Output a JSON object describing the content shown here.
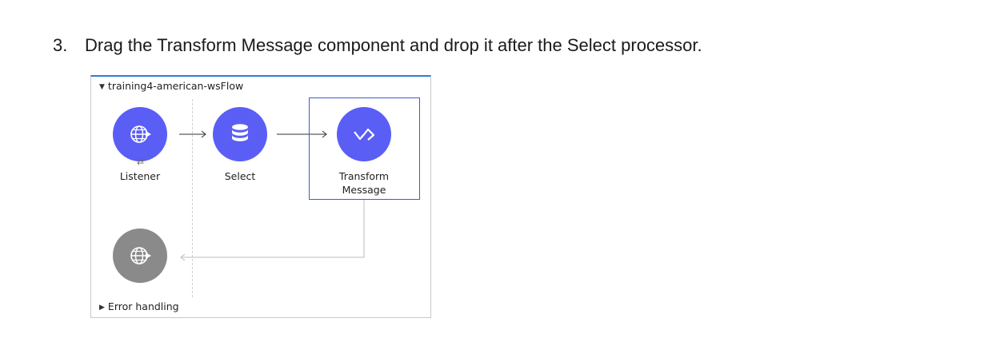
{
  "instruction": {
    "number": "3.",
    "text": "Drag the Transform Message component and drop it after the Select processor."
  },
  "flow": {
    "name": "training4-american-wsFlow",
    "nodes": [
      {
        "id": "listener",
        "label": "Listener",
        "icon": "globe-icon",
        "color": "#5a5ef5"
      },
      {
        "id": "select",
        "label": "Select",
        "icon": "database-icon",
        "color": "#5a5ef5"
      },
      {
        "id": "transform",
        "label_line1": "Transform",
        "label_line2": "Message",
        "icon": "dataweave-icon",
        "color": "#5a5ef5"
      }
    ],
    "response_node": {
      "icon": "globe-icon",
      "color": "#8a8a8a"
    },
    "error_handling_label": "Error handling"
  }
}
